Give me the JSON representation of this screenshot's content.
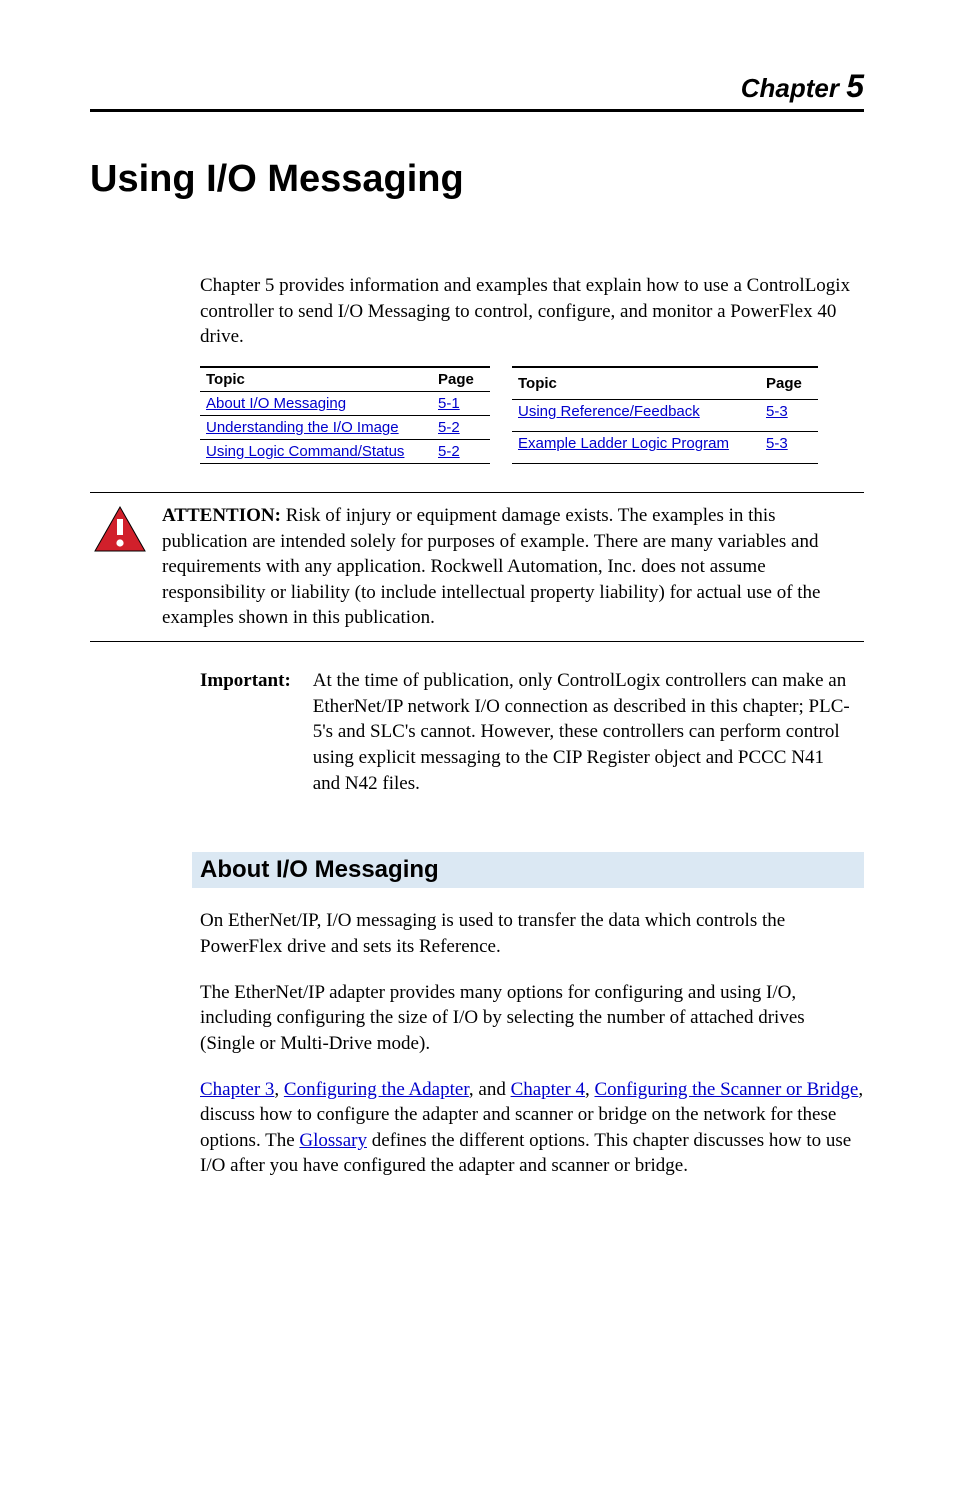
{
  "header": {
    "chapter_label": "Chapter",
    "chapter_number": "5"
  },
  "title": "Using I/O Messaging",
  "intro": "Chapter 5 provides information and examples that explain how to use a ControlLogix controller to send I/O Messaging to control, configure, and monitor a PowerFlex 40 drive.",
  "tables": {
    "left": {
      "headers": {
        "topic": "Topic",
        "page": "Page"
      },
      "rows": [
        {
          "topic": "About I/O Messaging",
          "page": "5-1"
        },
        {
          "topic": "Understanding the I/O Image",
          "page": "5-2"
        },
        {
          "topic": "Using Logic Command/Status",
          "page": "5-2"
        }
      ]
    },
    "right": {
      "headers": {
        "topic": "Topic",
        "page": "Page"
      },
      "rows": [
        {
          "topic": "Using Reference/Feedback",
          "page": "5-3"
        },
        {
          "topic": "Example Ladder Logic Program",
          "page": "5-3"
        }
      ]
    }
  },
  "attention": {
    "lead": "ATTENTION:",
    "text": "Risk of injury or equipment damage exists. The examples in this publication are intended solely for purposes of example. There are many variables and requirements with any application. Rockwell Automation, Inc. does not assume responsibility or liability (to include intellectual property liability) for actual use of the examples shown in this publication."
  },
  "important": {
    "lead": "Important:",
    "text": "At the time of publication, only ControlLogix controllers can make an EtherNet/IP network I/O connection as described in this chapter; PLC-5's and SLC's cannot. However, these controllers can perform control using explicit messaging to the CIP Register object and PCCC N41 and N42 files."
  },
  "section": {
    "heading": "About I/O Messaging",
    "p1": "On EtherNet/IP, I/O messaging is used to transfer the data which controls the PowerFlex drive and sets its Reference.",
    "p2": "The EtherNet/IP adapter provides many options for configuring and using I/O, including configuring the size of I/O by selecting the number of attached drives (Single or Multi-Drive mode).",
    "p3_parts": {
      "link1": "Chapter 3",
      "sep1": ", ",
      "link2": "Configuring the Adapter",
      "sep2": ", and ",
      "link3": "Chapter 4",
      "sep3": ", ",
      "link4": "Configuring the Scanner or Bridge",
      "sep4": ", discuss how to configure the adapter and scanner or bridge on the network for these options. The ",
      "link5": "Glossary",
      "sep5": " defines the different options. This chapter discusses how to use I/O after you have configured the adapter and scanner or bridge."
    }
  }
}
